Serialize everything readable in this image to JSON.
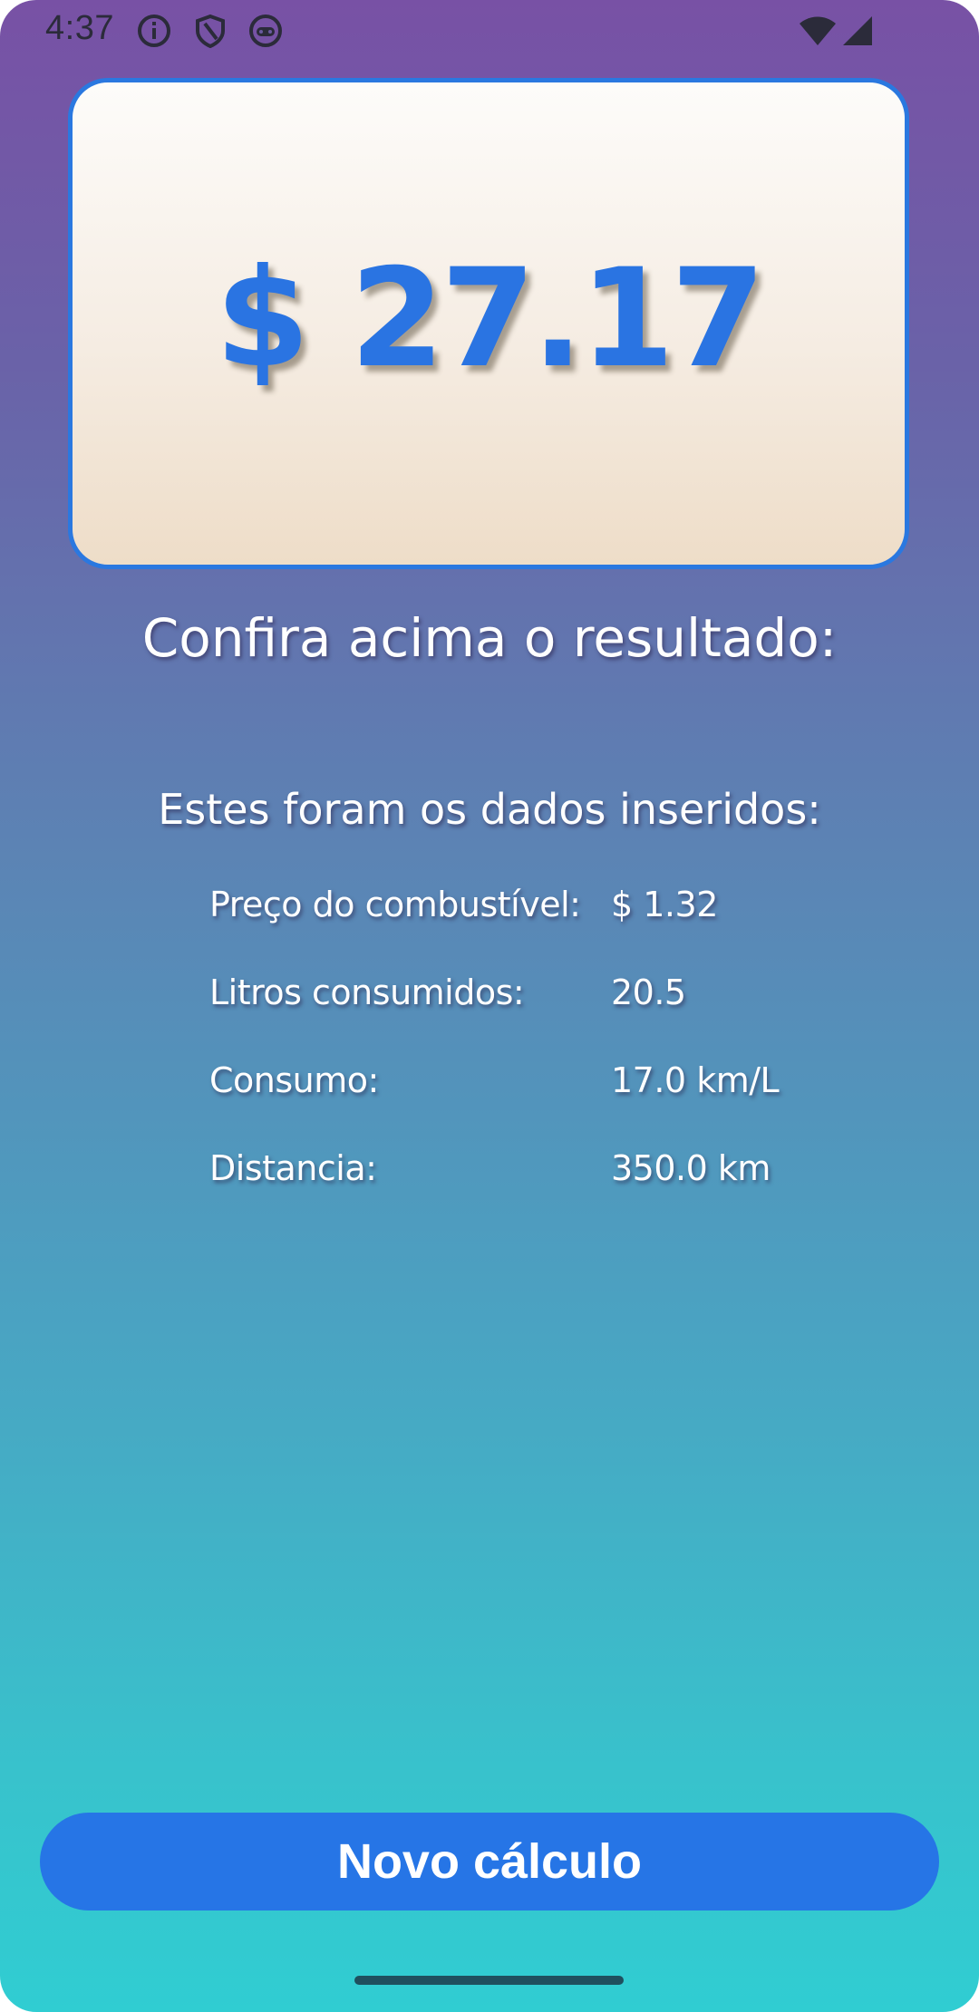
{
  "status_bar": {
    "time": "4:37",
    "icons": [
      "info-icon",
      "shield-icon",
      "robot-icon"
    ],
    "right_icons": [
      "wifi-icon",
      "cell-signal-icon"
    ]
  },
  "result": {
    "value": "$ 27.17"
  },
  "headings": {
    "result_caption": "Confira acima o resultado:",
    "data_caption": "Estes foram os dados inseridos:"
  },
  "inputs": [
    {
      "label": "Preço do combustível:",
      "value": "$ 1.32"
    },
    {
      "label": "Litros consumidos:",
      "value": "20.5"
    },
    {
      "label": "Consumo:",
      "value": "17.0 km/L"
    },
    {
      "label": "Distancia:",
      "value": "350.0 km"
    }
  ],
  "actions": {
    "new_calc_label": "Novo cálculo"
  },
  "colors": {
    "accent": "#2675e6",
    "gradient_top": "#7851a5",
    "gradient_bottom": "#30cdd2",
    "card_border": "#2a78e0"
  }
}
